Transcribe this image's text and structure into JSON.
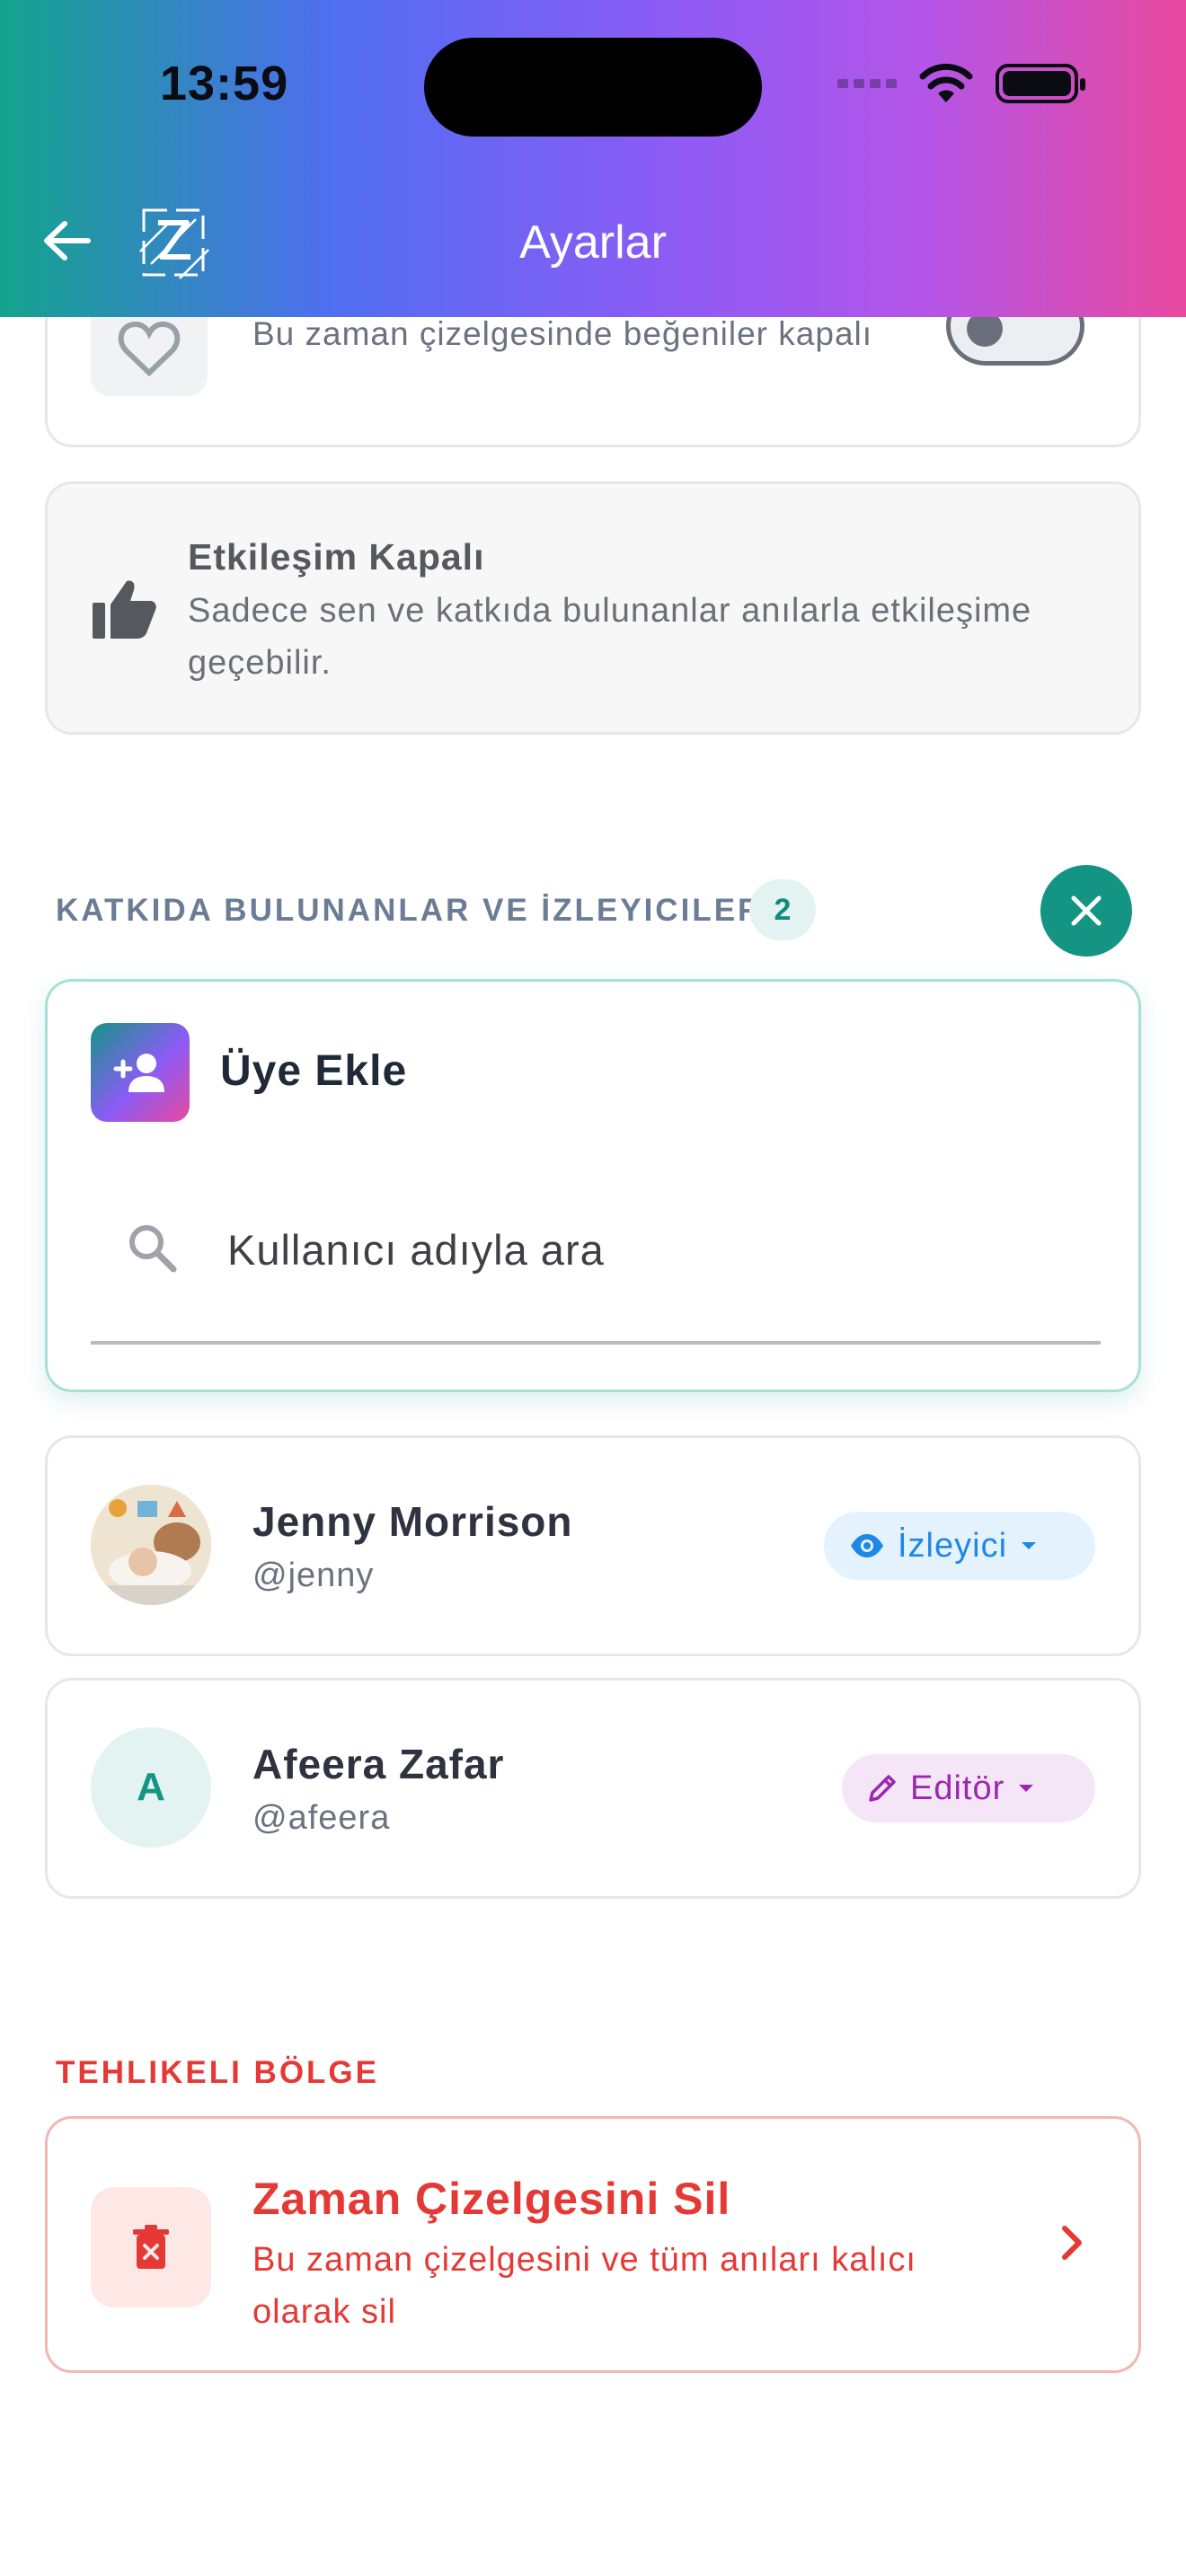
{
  "status_bar": {
    "time": "13:59"
  },
  "header": {
    "title": "Ayarlar"
  },
  "likes_setting": {
    "description": "Bu zaman çizelgesinde beğeniler kapalı"
  },
  "interaction": {
    "title": "Etkileşim Kapalı",
    "description": "Sadece sen ve katkıda bulunanlar anılarla etkileşime geçebilir."
  },
  "contributors": {
    "section_label": "KATKIDA BULUNANLAR VE İZLEYICILER",
    "count": "2",
    "add_member": {
      "title": "Üye Ekle",
      "search_placeholder": "Kullanıcı adıyla ara"
    },
    "members": [
      {
        "name": "Jenny Morrison",
        "handle": "@jenny",
        "role": "İzleyici",
        "avatar": "photo"
      },
      {
        "name": "Afeera Zafar",
        "handle": "@afeera",
        "role": "Editör",
        "avatar_letter": "A"
      }
    ]
  },
  "danger_zone": {
    "section_label": "TEHLIKELI BÖLGE",
    "delete_title": "Zaman Çizelgesini Sil",
    "delete_description": "Bu zaman çizelgesini ve tüm anıları kalıcı olarak sil"
  },
  "colors": {
    "accent_teal": "#149584",
    "danger": "#e53935",
    "viewer": "#1e88e5",
    "editor": "#9c27b0"
  }
}
